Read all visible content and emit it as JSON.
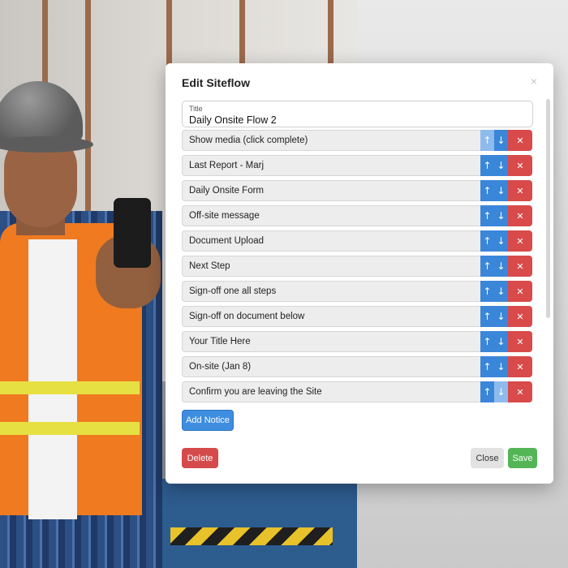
{
  "modal": {
    "title": "Edit Siteflow",
    "close_icon": "×",
    "title_field": {
      "label": "Title",
      "value": "Daily Onsite Flow 2"
    },
    "icons": {
      "up": "↑",
      "down": "↓",
      "delete": "✕"
    },
    "steps": [
      {
        "label": "Show media (click complete)",
        "up_disabled": true,
        "down_disabled": false
      },
      {
        "label": "Last Report - Marj",
        "up_disabled": false,
        "down_disabled": false
      },
      {
        "label": "Daily Onsite Form",
        "up_disabled": false,
        "down_disabled": false
      },
      {
        "label": "Off-site message",
        "up_disabled": false,
        "down_disabled": false
      },
      {
        "label": "Document Upload",
        "up_disabled": false,
        "down_disabled": false
      },
      {
        "label": "Next Step",
        "up_disabled": false,
        "down_disabled": false
      },
      {
        "label": "Sign-off one all steps",
        "up_disabled": false,
        "down_disabled": false
      },
      {
        "label": "Sign-off on document below",
        "up_disabled": false,
        "down_disabled": false
      },
      {
        "label": "Your Title Here",
        "up_disabled": false,
        "down_disabled": false
      },
      {
        "label": "On-site (Jan 8)",
        "up_disabled": false,
        "down_disabled": false
      },
      {
        "label": "Confirm you are leaving the Site",
        "up_disabled": false,
        "down_disabled": true
      }
    ],
    "add_notice_label": "Add Notice",
    "delete_label": "Delete",
    "close_label": "Close",
    "save_label": "Save"
  },
  "colors": {
    "primary": "#3a86d9",
    "primary_disabled": "#8ebbee",
    "danger": "#d94a4a",
    "success": "#54b557",
    "neutral": "#e2e2e2"
  }
}
